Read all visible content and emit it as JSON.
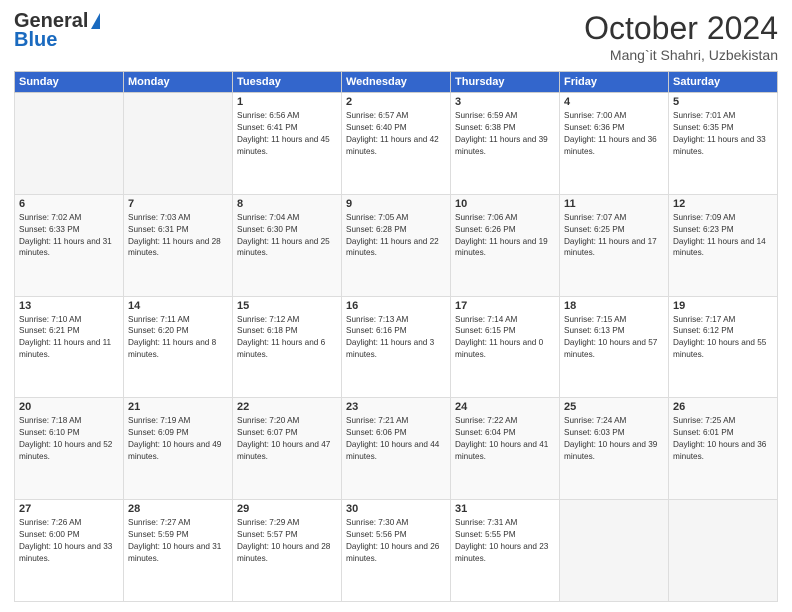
{
  "header": {
    "logo_line1": "General",
    "logo_line2": "Blue",
    "month": "October 2024",
    "location": "Mang`it Shahri, Uzbekistan"
  },
  "days_of_week": [
    "Sunday",
    "Monday",
    "Tuesday",
    "Wednesday",
    "Thursday",
    "Friday",
    "Saturday"
  ],
  "weeks": [
    [
      {
        "day": "",
        "empty": true
      },
      {
        "day": "",
        "empty": true
      },
      {
        "day": "1",
        "sunrise": "6:56 AM",
        "sunset": "6:41 PM",
        "daylight": "11 hours and 45 minutes."
      },
      {
        "day": "2",
        "sunrise": "6:57 AM",
        "sunset": "6:40 PM",
        "daylight": "11 hours and 42 minutes."
      },
      {
        "day": "3",
        "sunrise": "6:59 AM",
        "sunset": "6:38 PM",
        "daylight": "11 hours and 39 minutes."
      },
      {
        "day": "4",
        "sunrise": "7:00 AM",
        "sunset": "6:36 PM",
        "daylight": "11 hours and 36 minutes."
      },
      {
        "day": "5",
        "sunrise": "7:01 AM",
        "sunset": "6:35 PM",
        "daylight": "11 hours and 33 minutes."
      }
    ],
    [
      {
        "day": "6",
        "sunrise": "7:02 AM",
        "sunset": "6:33 PM",
        "daylight": "11 hours and 31 minutes."
      },
      {
        "day": "7",
        "sunrise": "7:03 AM",
        "sunset": "6:31 PM",
        "daylight": "11 hours and 28 minutes."
      },
      {
        "day": "8",
        "sunrise": "7:04 AM",
        "sunset": "6:30 PM",
        "daylight": "11 hours and 25 minutes."
      },
      {
        "day": "9",
        "sunrise": "7:05 AM",
        "sunset": "6:28 PM",
        "daylight": "11 hours and 22 minutes."
      },
      {
        "day": "10",
        "sunrise": "7:06 AM",
        "sunset": "6:26 PM",
        "daylight": "11 hours and 19 minutes."
      },
      {
        "day": "11",
        "sunrise": "7:07 AM",
        "sunset": "6:25 PM",
        "daylight": "11 hours and 17 minutes."
      },
      {
        "day": "12",
        "sunrise": "7:09 AM",
        "sunset": "6:23 PM",
        "daylight": "11 hours and 14 minutes."
      }
    ],
    [
      {
        "day": "13",
        "sunrise": "7:10 AM",
        "sunset": "6:21 PM",
        "daylight": "11 hours and 11 minutes."
      },
      {
        "day": "14",
        "sunrise": "7:11 AM",
        "sunset": "6:20 PM",
        "daylight": "11 hours and 8 minutes."
      },
      {
        "day": "15",
        "sunrise": "7:12 AM",
        "sunset": "6:18 PM",
        "daylight": "11 hours and 6 minutes."
      },
      {
        "day": "16",
        "sunrise": "7:13 AM",
        "sunset": "6:16 PM",
        "daylight": "11 hours and 3 minutes."
      },
      {
        "day": "17",
        "sunrise": "7:14 AM",
        "sunset": "6:15 PM",
        "daylight": "11 hours and 0 minutes."
      },
      {
        "day": "18",
        "sunrise": "7:15 AM",
        "sunset": "6:13 PM",
        "daylight": "10 hours and 57 minutes."
      },
      {
        "day": "19",
        "sunrise": "7:17 AM",
        "sunset": "6:12 PM",
        "daylight": "10 hours and 55 minutes."
      }
    ],
    [
      {
        "day": "20",
        "sunrise": "7:18 AM",
        "sunset": "6:10 PM",
        "daylight": "10 hours and 52 minutes."
      },
      {
        "day": "21",
        "sunrise": "7:19 AM",
        "sunset": "6:09 PM",
        "daylight": "10 hours and 49 minutes."
      },
      {
        "day": "22",
        "sunrise": "7:20 AM",
        "sunset": "6:07 PM",
        "daylight": "10 hours and 47 minutes."
      },
      {
        "day": "23",
        "sunrise": "7:21 AM",
        "sunset": "6:06 PM",
        "daylight": "10 hours and 44 minutes."
      },
      {
        "day": "24",
        "sunrise": "7:22 AM",
        "sunset": "6:04 PM",
        "daylight": "10 hours and 41 minutes."
      },
      {
        "day": "25",
        "sunrise": "7:24 AM",
        "sunset": "6:03 PM",
        "daylight": "10 hours and 39 minutes."
      },
      {
        "day": "26",
        "sunrise": "7:25 AM",
        "sunset": "6:01 PM",
        "daylight": "10 hours and 36 minutes."
      }
    ],
    [
      {
        "day": "27",
        "sunrise": "7:26 AM",
        "sunset": "6:00 PM",
        "daylight": "10 hours and 33 minutes."
      },
      {
        "day": "28",
        "sunrise": "7:27 AM",
        "sunset": "5:59 PM",
        "daylight": "10 hours and 31 minutes."
      },
      {
        "day": "29",
        "sunrise": "7:29 AM",
        "sunset": "5:57 PM",
        "daylight": "10 hours and 28 minutes."
      },
      {
        "day": "30",
        "sunrise": "7:30 AM",
        "sunset": "5:56 PM",
        "daylight": "10 hours and 26 minutes."
      },
      {
        "day": "31",
        "sunrise": "7:31 AM",
        "sunset": "5:55 PM",
        "daylight": "10 hours and 23 minutes."
      },
      {
        "day": "",
        "empty": true
      },
      {
        "day": "",
        "empty": true
      }
    ]
  ]
}
